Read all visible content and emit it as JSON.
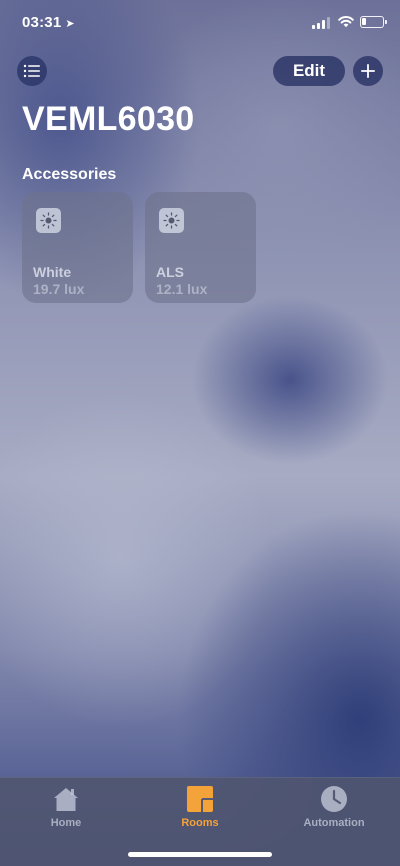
{
  "status_bar": {
    "time": "03:31",
    "location_icon": "location-arrow-icon",
    "signal_icon": "cellular-signal-icon",
    "wifi_icon": "wifi-icon",
    "battery_icon": "battery-icon",
    "battery_level": 0.2
  },
  "toolbar": {
    "menu_icon": "list-icon",
    "edit_label": "Edit",
    "add_icon": "plus-icon"
  },
  "room": {
    "title": "VEML6030",
    "section_label": "Accessories"
  },
  "accessories": [
    {
      "name": "White",
      "value": "19.7 lux",
      "icon": "light-sensor-icon"
    },
    {
      "name": "ALS",
      "value": "12.1 lux",
      "icon": "light-sensor-icon"
    }
  ],
  "tabs": [
    {
      "label": "Home",
      "icon": "house-icon",
      "active": false
    },
    {
      "label": "Rooms",
      "icon": "rooms-icon",
      "active": true
    },
    {
      "label": "Automation",
      "icon": "clock-icon",
      "active": false
    }
  ],
  "colors": {
    "accent": "#f4a23a",
    "button_bg": "#28326a"
  }
}
